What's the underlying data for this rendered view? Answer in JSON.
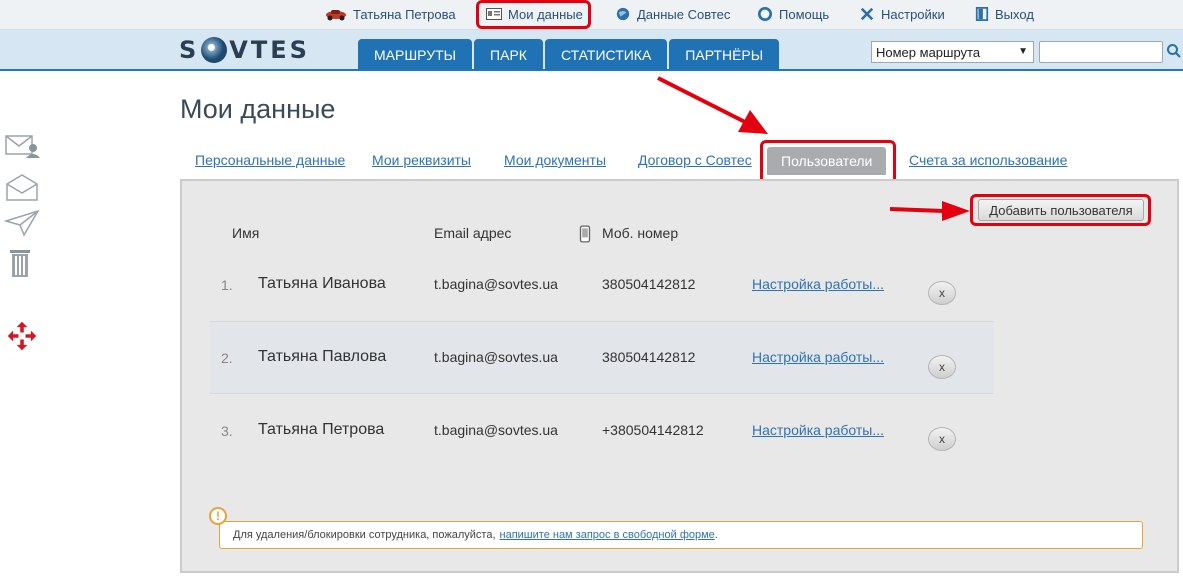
{
  "topbar": {
    "user_name": "Татьяна Петрова",
    "my_data": "Мои данные",
    "sovtes_data": "Данные Совтес",
    "help": "Помощь",
    "settings": "Настройки",
    "logout": "Выход"
  },
  "header": {
    "logo": "SOVTES",
    "nav": [
      "МАРШРУТЫ",
      "ПАРК",
      "СТАТИСТИКА",
      "ПАРТНЁРЫ"
    ],
    "route_select": "Номер маршрута",
    "search_placeholder": ""
  },
  "page": {
    "title": "Мои данные",
    "subtabs": [
      "Персональные данные",
      "Мои реквизиты",
      "Мои документы",
      "Договор с Совтес",
      "Пользователи",
      "Счета за использование"
    ],
    "add_user": "Добавить пользователя",
    "columns": {
      "name": "Имя",
      "email": "Email адрес",
      "phone": "Моб. номер"
    },
    "users": [
      {
        "num": "1.",
        "name": "Татьяна Иванова",
        "email": "t.bagina@sovtes.ua",
        "phone": "380504142812",
        "link": "Настройка работы...",
        "del": "x"
      },
      {
        "num": "2.",
        "name": "Татьяна Павлова",
        "email": "t.bagina@sovtes.ua",
        "phone": "380504142812",
        "link": "Настройка работы...",
        "del": "x"
      },
      {
        "num": "3.",
        "name": "Татьяна Петрова",
        "email": "t.bagina@sovtes.ua",
        "phone": "+380504142812",
        "link": "Настройка работы...",
        "del": "x"
      }
    ],
    "notice_text": "Для удаления/блокировки сотрудника, пожалуйста,",
    "notice_link": "напишите нам запрос в свободной форме",
    "notice_end": ".",
    "notice_icon": "!"
  },
  "colors": {
    "accent": "#1f73b4",
    "highlight": "#e3000f",
    "warning": "#e8a23c"
  }
}
